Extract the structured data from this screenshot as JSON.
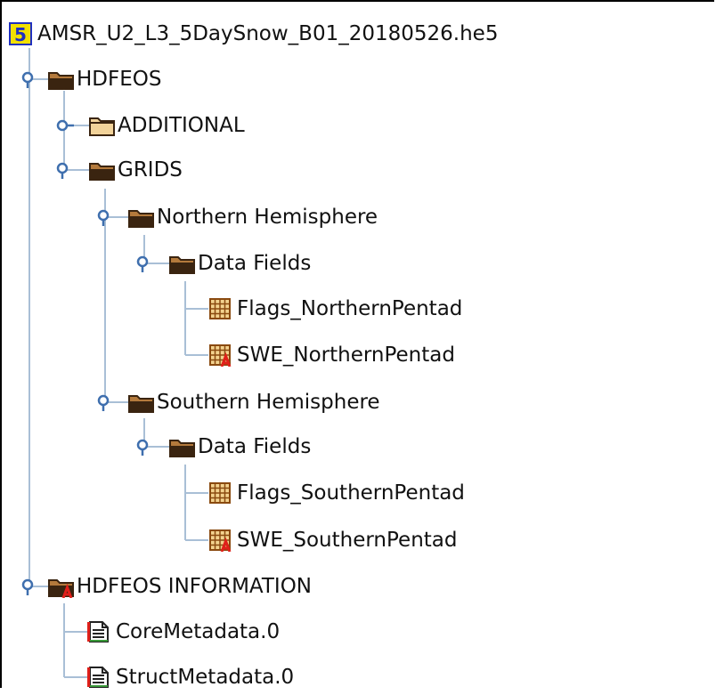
{
  "tree": {
    "root": {
      "label": "AMSR_U2_L3_5DaySnow_B01_20180526.he5",
      "icon": "hdf5-file-icon"
    },
    "hdfeos": {
      "label": "HDFEOS",
      "icon": "folder-open-icon"
    },
    "additional": {
      "label": "ADDITIONAL",
      "icon": "folder-closed-icon"
    },
    "grids": {
      "label": "GRIDS",
      "icon": "folder-open-icon"
    },
    "northern": {
      "label": "Northern Hemisphere",
      "icon": "folder-open-icon"
    },
    "northern_data_fields": {
      "label": "Data Fields",
      "icon": "folder-open-icon"
    },
    "flags_northern": {
      "label": "Flags_NorthernPentad",
      "icon": "dataset-grid-icon"
    },
    "swe_northern": {
      "label": "SWE_NorthernPentad",
      "icon": "dataset-grid-attr-icon"
    },
    "southern": {
      "label": "Southern Hemisphere",
      "icon": "folder-open-icon"
    },
    "southern_data_fields": {
      "label": "Data Fields",
      "icon": "folder-open-icon"
    },
    "flags_southern": {
      "label": "Flags_SouthernPentad",
      "icon": "dataset-grid-icon"
    },
    "swe_southern": {
      "label": "SWE_SouthernPentad",
      "icon": "dataset-grid-attr-icon"
    },
    "hdfeos_information": {
      "label": "HDFEOS INFORMATION",
      "icon": "folder-attr-icon"
    },
    "core_metadata": {
      "label": "CoreMetadata.0",
      "icon": "text-dataset-icon"
    },
    "struct_metadata": {
      "label": "StructMetadata.0",
      "icon": "text-dataset-icon"
    }
  },
  "colors": {
    "tree_line": "#a9bfd6",
    "handle": "#3f6fae",
    "folder": "#b47a3c",
    "folder_dark": "#3a2410",
    "attr_marker": "#e0201a",
    "hdf5_badge": "#f2e000",
    "hdf5_badge_text": "#2030c0"
  }
}
